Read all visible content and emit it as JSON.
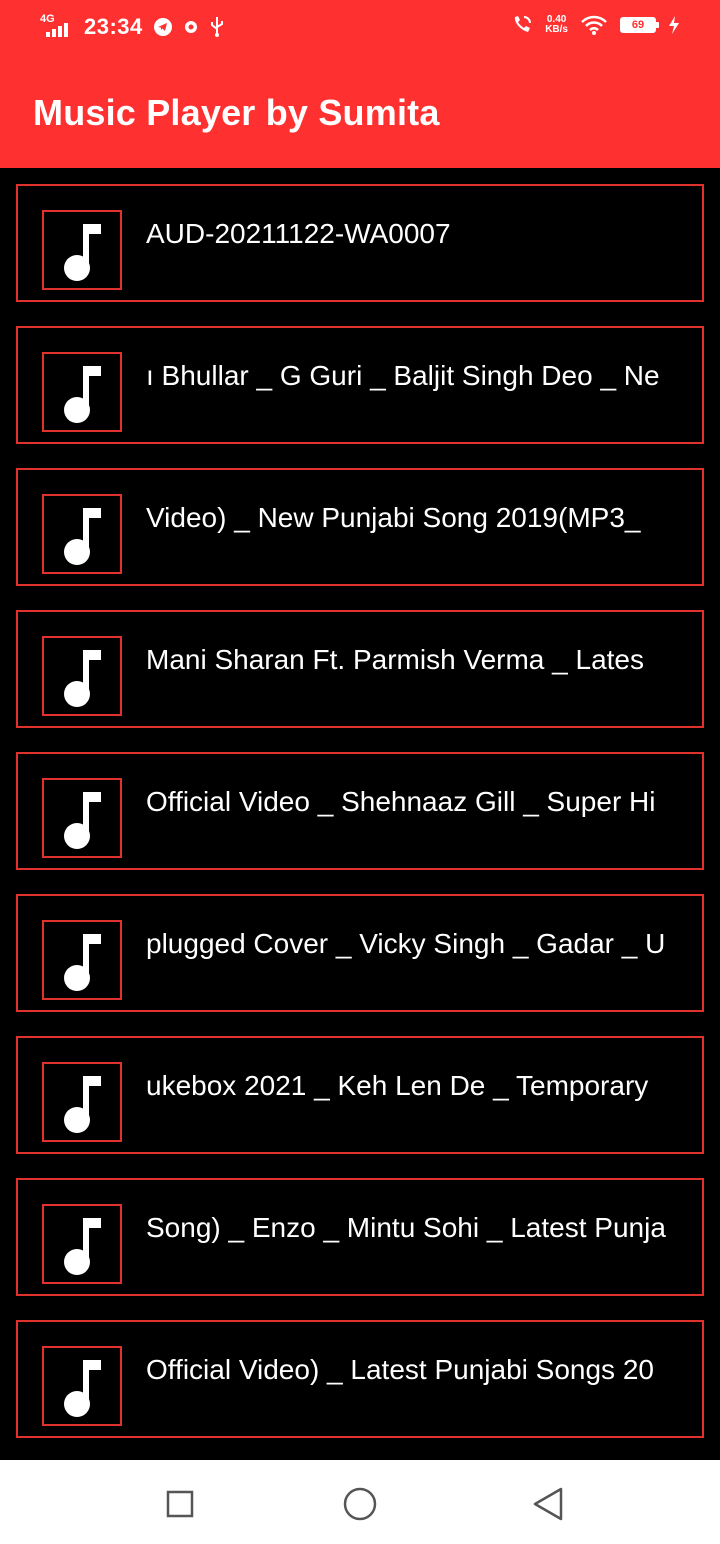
{
  "status_bar": {
    "network_label": "4G",
    "time": "23:34",
    "speed_value": "0.40",
    "speed_unit": "KB/s",
    "battery": "69"
  },
  "app_bar": {
    "title": "Music Player by Sumita"
  },
  "songs": [
    {
      "title": "AUD-20211122-WA0007",
      "icon": "music-note-icon"
    },
    {
      "title": "ı Bhullar _ G Guri _ Baljit Singh Deo _ Ne",
      "icon": "music-note-icon"
    },
    {
      "title": "Video) _ New Punjabi Song 2019(MP3_",
      "icon": "music-note-icon"
    },
    {
      "title": "Mani Sharan Ft. Parmish Verma _ Lates",
      "icon": "music-note-icon"
    },
    {
      "title": "Official Video _ Shehnaaz Gill _ Super Hi",
      "icon": "music-note-icon"
    },
    {
      "title": "plugged Cover _ Vicky Singh _ Gadar _ U",
      "icon": "music-note-icon"
    },
    {
      "title": "ukebox 2021 _ Keh Len De _ Temporary",
      "icon": "music-note-icon"
    },
    {
      "title": "Song) _ Enzo _ Mintu Sohi _ Latest Punja",
      "icon": "music-note-icon"
    },
    {
      "title": "Official Video) _ Latest Punjabi Songs 20",
      "icon": "music-note-icon"
    }
  ],
  "nav_bar": {
    "recents_icon": "square-icon",
    "home_icon": "circle-icon",
    "back_icon": "triangle-back-icon"
  },
  "colors": {
    "accent": "#ff3030",
    "border": "#e0312c",
    "background": "#000000"
  }
}
